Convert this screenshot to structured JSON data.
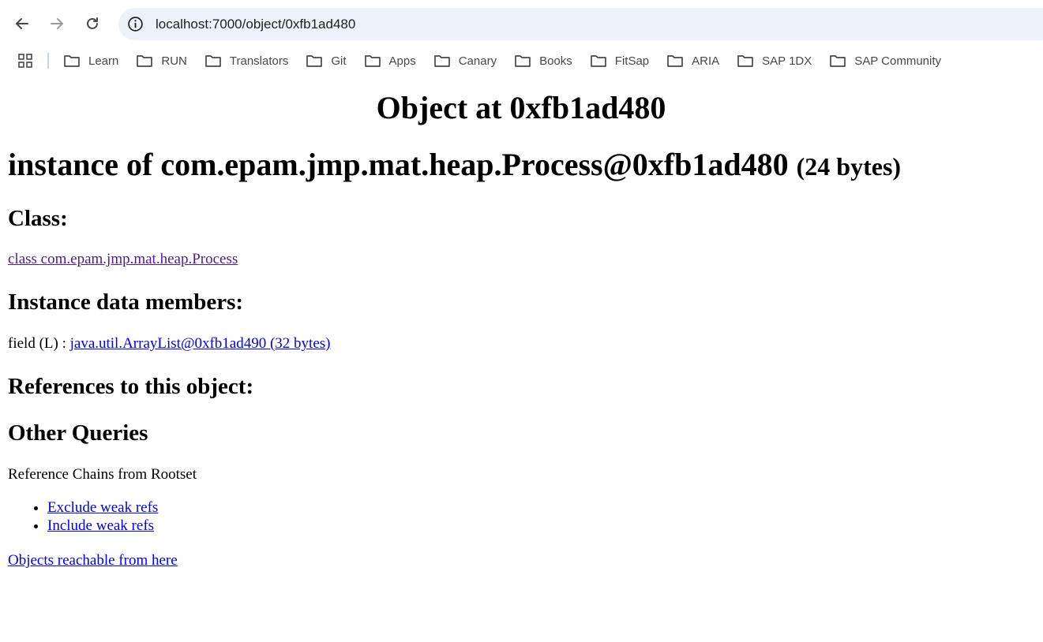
{
  "browser": {
    "url": "localhost:7000/object/0xfb1ad480",
    "icons": {
      "back": "arrow-left-icon",
      "forward": "arrow-right-icon",
      "reload": "reload-icon",
      "site_info": "info-icon",
      "apps": "apps-grid-icon",
      "folder": "folder-icon"
    },
    "bookmarks": [
      "Learn",
      "RUN",
      "Translators",
      "Git",
      "Apps",
      "Canary",
      "Books",
      "FitSap",
      "ARIA",
      "SAP 1DX",
      "SAP Community"
    ]
  },
  "page": {
    "title": "Object at 0xfb1ad480",
    "instance_label": "instance of com.epam.jmp.mat.heap.Process@0xfb1ad480",
    "instance_size": "(24 bytes)",
    "class_heading": "Class:",
    "class_link": "class com.epam.jmp.mat.heap.Process",
    "members_heading": "Instance data members:",
    "member_field": "field (L) : ",
    "member_link": "java.util.ArrayList@0xfb1ad490 (32 bytes)",
    "references_heading": "References to this object:",
    "queries_heading": "Other Queries",
    "chains_label": "Reference Chains from Rootset",
    "chain_links": [
      "Exclude weak refs",
      "Include weak refs"
    ],
    "reachable_link": "Objects reachable from here"
  },
  "colors": {
    "link": "#0000ee",
    "visited_link": "#551a8b",
    "omnibox_bg": "#edf2fa"
  }
}
